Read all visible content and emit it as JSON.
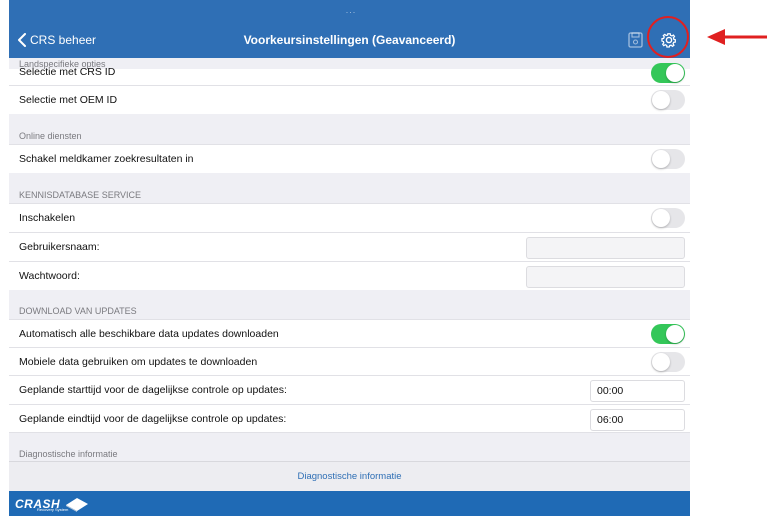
{
  "nav": {
    "back_label": "CRS beheer",
    "title": "Voorkeursinstellingen (Geavanceerd)",
    "dots": "..."
  },
  "sections": {
    "landspecifiek": "Landspecifieke opties",
    "online": "Online diensten",
    "kennis": "KENNISDATABASE SERVICE",
    "download": "DOWNLOAD VAN UPDATES",
    "diagnostisch": "Diagnostische informatie"
  },
  "rows": {
    "crs_id": {
      "label": "Selectie met CRS ID",
      "on": true
    },
    "oem_id": {
      "label": "Selectie met OEM ID",
      "on": false
    },
    "meldkamer": {
      "label": "Schakel meldkamer zoekresultaten in",
      "on": false
    },
    "inschakelen": {
      "label": "Inschakelen",
      "on": false
    },
    "gebruikersnaam": {
      "label": "Gebruikersnaam:",
      "value": ""
    },
    "wachtwoord": {
      "label": "Wachtwoord:",
      "value": ""
    },
    "auto_download": {
      "label": "Automatisch alle beschikbare data updates downloaden",
      "on": true
    },
    "mobiele_data": {
      "label": "Mobiele data gebruiken om updates te downloaden",
      "on": false
    },
    "starttijd": {
      "label": "Geplande starttijd voor de dagelijkse controle op updates:",
      "value": "00:00"
    },
    "eindtijd": {
      "label": "Geplande eindtijd voor de dagelijkse controle op updates:",
      "value": "06:00"
    }
  },
  "diagnostics_button": "Diagnostische informatie",
  "footer": {
    "logo_text": "CRASH",
    "logo_sub": "Recovery System"
  },
  "colors": {
    "nav": "#2f6fb5",
    "toggle_on": "#34c759",
    "annotation": "#e02020"
  }
}
